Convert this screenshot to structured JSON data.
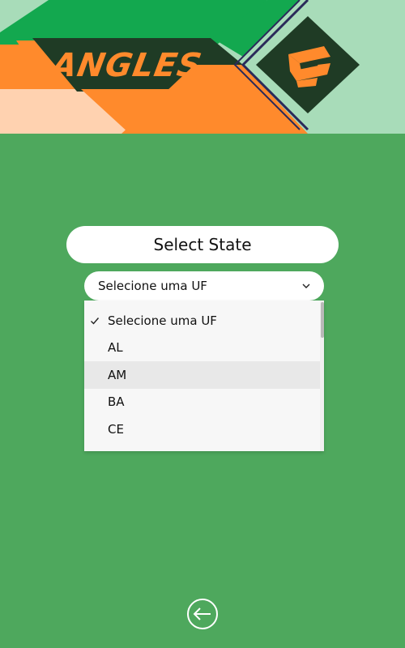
{
  "banner": {
    "logo_text": "ANGLES",
    "logo_icon": "angles-s-logo-icon"
  },
  "title_pill": {
    "label": "Select State"
  },
  "state_select": {
    "selected_value": "Selecione uma UF",
    "icon": "chevron-down-icon"
  },
  "dropdown": {
    "options": [
      {
        "label": "Selecione uma UF",
        "selected": true
      },
      {
        "label": "AL",
        "selected": false
      },
      {
        "label": "AM",
        "selected": false
      },
      {
        "label": "BA",
        "selected": false
      },
      {
        "label": "CE",
        "selected": false
      }
    ],
    "hovered_index": 2,
    "check_icon": "checkmark-icon"
  },
  "back_button": {
    "icon": "back-arrow-icon"
  },
  "colors": {
    "background": "#4ea85d",
    "banner_dark_green": "#1f3b25",
    "banner_green": "#13a84f",
    "banner_light_green": "#a8dcb9",
    "banner_orange": "#ff8a2c",
    "banner_peach": "#ffd2b0",
    "banner_navy": "#2a2a5a",
    "white": "#ffffff"
  }
}
